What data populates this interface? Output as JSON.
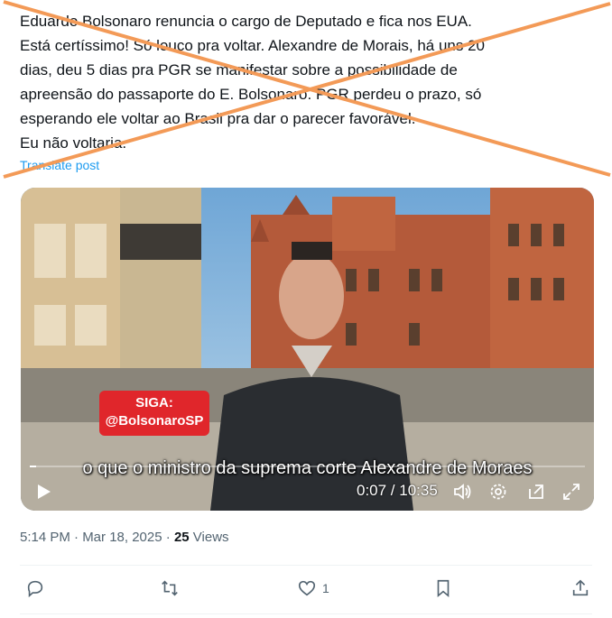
{
  "post": {
    "lines": [
      "Eduardo Bolsonaro renuncia o cargo de Deputado e fica nos EUA.",
      "Está certíssimo! Só louco pra voltar. Alexandre de Morais, há uns 20",
      "dias, deu 5 dias pra PGR se manifestar sobre a possibilidade de",
      "apreensão do passaporte do E. Bolsonaro. PGR perdeu o prazo, só",
      "esperando ele voltar ao Brasil pra dar o parecer favorável.",
      "Eu não voltaria."
    ],
    "translate_label": "Translate post"
  },
  "video": {
    "badge_line1": "SIGA:",
    "badge_line2": "@BolsonaroSP",
    "caption": "o que o ministro da suprema corte Alexandre de Moraes",
    "time": "0:07 / 10:35",
    "progress": 0.011
  },
  "meta": {
    "timestamp": "5:14 PM · Mar 18, 2025",
    "separator": " · ",
    "views_count": "25",
    "views_label": " Views"
  },
  "actions": {
    "like_count": "1"
  },
  "colors": {
    "accent": "#1d9bf0",
    "cross": "#f39a57",
    "badge": "#e0262b"
  },
  "icons": [
    "play-icon",
    "volume-icon",
    "settings-icon",
    "pip-icon",
    "fullscreen-icon",
    "reply-icon",
    "repost-icon",
    "like-icon",
    "bookmark-icon",
    "share-icon"
  ]
}
